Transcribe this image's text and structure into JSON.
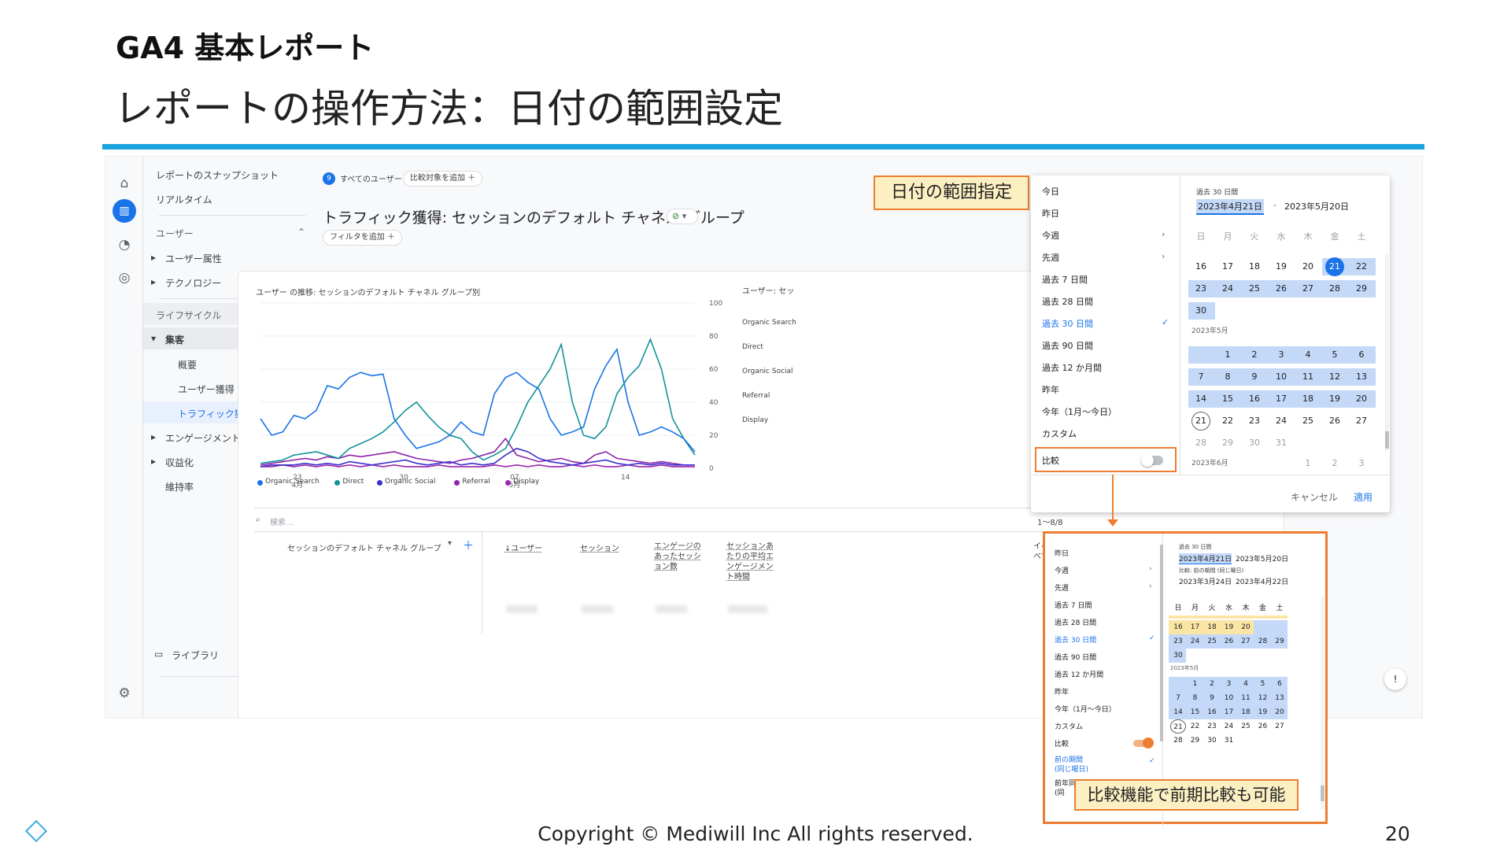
{
  "slide": {
    "title": "GA4 基本レポート",
    "subtitle": "レポートの操作方法：日付の範囲設定",
    "copyright": "Copyright © Mediwill Inc All rights reserved.",
    "page_number": "20",
    "accent_color": "#1aa3dd",
    "callout_color": "#ed7d31"
  },
  "callouts": {
    "date_range": "日付の範囲指定",
    "compare": "比較機能で前期比較も可能"
  },
  "nav": {
    "snapshot": "レポートのスナップショット",
    "realtime": "リアルタイム",
    "user_section": "ユーザー",
    "user_attr": "ユーザー属性",
    "technology": "テクノロジー",
    "lifecycle_section": "ライフサイクル",
    "acquisition": "集客",
    "overview": "概要",
    "user_acq": "ユーザー獲得",
    "traffic_acq": "トラフィック獲得",
    "engagement": "エンゲージメント",
    "monetization": "収益化",
    "retention": "維持率",
    "library": "ライブラリ",
    "collapse": "‹"
  },
  "header": {
    "segment": "すべてのユーザー",
    "segment_badge": "9",
    "add_compare": "比較対象を追加 ＋",
    "report_title": "トラフィック獲得: セッションのデフォルト チャネル グループ",
    "add_filter": "フィルタを追加 ＋"
  },
  "chart_data": {
    "type": "line",
    "title": "ユーザー の推移: セッションのデフォルト チャネル グループ別",
    "x_ticks": [
      "23 4月",
      "30",
      "07 5月",
      "14"
    ],
    "ylim": [
      0,
      100
    ],
    "y_ticks": [
      "100",
      "80",
      "60",
      "40",
      "20",
      "0"
    ],
    "legend_position": "bottom",
    "series": [
      {
        "name": "Organic Search",
        "color": "#1a73e8",
        "values": [
          30,
          20,
          22,
          32,
          30,
          35,
          50,
          48,
          55,
          58,
          56,
          57,
          30,
          20,
          12,
          14,
          16,
          20,
          28,
          22,
          20,
          45,
          55,
          58,
          52,
          48,
          30,
          20,
          22,
          25,
          48,
          62,
          72,
          40,
          20,
          22,
          25,
          22,
          18,
          10
        ]
      },
      {
        "name": "Direct",
        "color": "#12939a",
        "values": [
          3,
          4,
          5,
          8,
          9,
          10,
          8,
          6,
          12,
          15,
          18,
          22,
          28,
          35,
          40,
          32,
          25,
          20,
          18,
          10,
          5,
          8,
          12,
          25,
          40,
          50,
          60,
          75,
          40,
          20,
          18,
          25,
          45,
          55,
          62,
          78,
          60,
          30,
          18,
          8
        ]
      },
      {
        "name": "Organic Social",
        "color": "#3b30c9",
        "values": [
          1,
          2,
          2,
          2,
          3,
          2,
          3,
          2,
          4,
          3,
          2,
          3,
          4,
          5,
          3,
          2,
          3,
          4,
          2,
          3,
          2,
          3,
          8,
          12,
          10,
          6,
          4,
          3,
          2,
          3,
          4,
          5,
          3,
          2,
          3,
          2,
          3,
          2,
          2,
          2
        ]
      },
      {
        "name": "Referral",
        "color": "#8e24aa",
        "values": [
          2,
          3,
          4,
          5,
          6,
          5,
          7,
          6,
          8,
          7,
          8,
          9,
          10,
          8,
          6,
          5,
          4,
          3,
          5,
          6,
          8,
          10,
          18,
          8,
          6,
          4,
          5,
          6,
          4,
          3,
          8,
          10,
          6,
          5,
          4,
          3,
          4,
          3,
          2,
          2
        ]
      },
      {
        "name": "Display",
        "color": "#9c27b0",
        "values": [
          1,
          1,
          2,
          1,
          2,
          1,
          2,
          1,
          2,
          1,
          2,
          1,
          2,
          1,
          1,
          1,
          2,
          1,
          1,
          1,
          1,
          2,
          1,
          2,
          1,
          2,
          1,
          1,
          2,
          1,
          2,
          1,
          1,
          2,
          1,
          1,
          2,
          1,
          1,
          1
        ]
      }
    ]
  },
  "right_panel": {
    "heading": "ユーザー: セッ",
    "rows": [
      "Organic Search",
      "Direct",
      "Organic Social",
      "Referral",
      "Display"
    ]
  },
  "table": {
    "search_placeholder": "検索...",
    "pagination": "1〜8/8",
    "dimension_header": "セッションのデフォルト チャネル グループ",
    "columns": [
      "↓ユーザー",
      "セッション",
      "エンゲージのあったセッション数",
      "セッションあたりの平均エンゲージメント時間"
    ],
    "event_header": "イベン(すべてのイベ"
  },
  "datepicker": {
    "presets": [
      "今日",
      "昨日",
      "今週",
      "先週",
      "過去 7 日間",
      "過去 28 日間",
      "過去 30 日間",
      "過去 90 日間",
      "過去 12 か月間",
      "昨年",
      "今年（1月〜今日）",
      "カスタム"
    ],
    "selected": "過去 30 日間",
    "compare_label": "比較",
    "range_label": "過去 30 日間",
    "start": "2023年4月21日",
    "end": "2023年5月20日",
    "weekdays": [
      "日",
      "月",
      "火",
      "水",
      "木",
      "金",
      "土"
    ],
    "april_row1": [
      "16",
      "17",
      "18",
      "19",
      "20",
      "21",
      "22"
    ],
    "april_row2": [
      "23",
      "24",
      "25",
      "26",
      "27",
      "28",
      "29"
    ],
    "april_row3": [
      "30"
    ],
    "may_label": "2023年5月",
    "may_row1": [
      "1",
      "2",
      "3",
      "4",
      "5",
      "6"
    ],
    "may_row2": [
      "7",
      "8",
      "9",
      "10",
      "11",
      "12",
      "13"
    ],
    "may_row3": [
      "14",
      "15",
      "16",
      "17",
      "18",
      "19",
      "20"
    ],
    "may_row4": [
      "21",
      "22",
      "23",
      "24",
      "25",
      "26",
      "27"
    ],
    "may_row5": [
      "28",
      "29",
      "30",
      "31"
    ],
    "june_label": "2023年6月",
    "june_row": [
      "1",
      "2",
      "3"
    ],
    "cancel": "キャンセル",
    "apply": "適用"
  },
  "datepicker2": {
    "compare_range_label": "比較: 前の期間 (同じ曜日)",
    "compare_start": "2023年3月24日",
    "compare_end": "2023年4月22日",
    "prev_period": "前の期間",
    "prev_period_sub": "(同じ曜日)",
    "prev_year": "前年同期",
    "prev_year_sub": "(同"
  }
}
